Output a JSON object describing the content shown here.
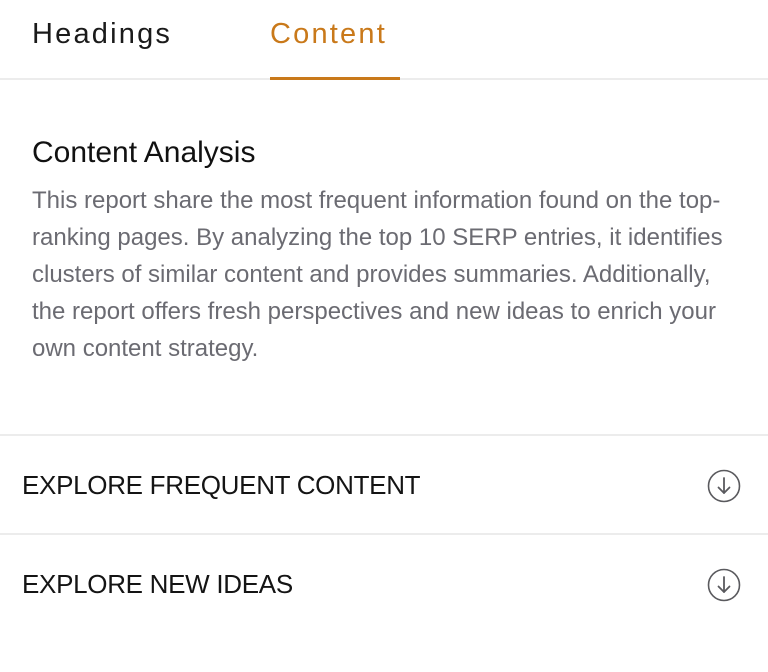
{
  "tabs": [
    {
      "label": "Headings",
      "active": false
    },
    {
      "label": "Content",
      "active": true
    }
  ],
  "colors": {
    "accent": "#c9791a",
    "body_text": "#6b6b72",
    "divider": "#ececec"
  },
  "analysis": {
    "title": "Content Analysis",
    "description": "This report share the most frequent information found on the top-ranking pages. By analyzing the top 10 SERP entries, it identifies clusters of similar content and provides summaries. Additionally, the report offers fresh perspectives and new ideas to enrich your own content strategy."
  },
  "accordion": [
    {
      "label": "EXPLORE FREQUENT CONTENT",
      "icon": "arrow-down-circle-icon"
    },
    {
      "label": "EXPLORE NEW IDEAS",
      "icon": "arrow-down-circle-icon"
    }
  ]
}
